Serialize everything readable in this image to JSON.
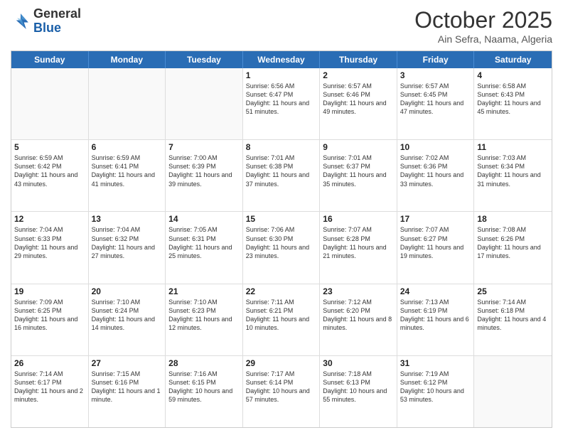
{
  "header": {
    "logo_general": "General",
    "logo_blue": "Blue",
    "month_title": "October 2025",
    "subtitle": "Ain Sefra, Naama, Algeria"
  },
  "days_of_week": [
    "Sunday",
    "Monday",
    "Tuesday",
    "Wednesday",
    "Thursday",
    "Friday",
    "Saturday"
  ],
  "rows": [
    [
      {
        "day": "",
        "sunrise": "",
        "sunset": "",
        "daylight": ""
      },
      {
        "day": "",
        "sunrise": "",
        "sunset": "",
        "daylight": ""
      },
      {
        "day": "",
        "sunrise": "",
        "sunset": "",
        "daylight": ""
      },
      {
        "day": "1",
        "sunrise": "Sunrise: 6:56 AM",
        "sunset": "Sunset: 6:47 PM",
        "daylight": "Daylight: 11 hours and 51 minutes."
      },
      {
        "day": "2",
        "sunrise": "Sunrise: 6:57 AM",
        "sunset": "Sunset: 6:46 PM",
        "daylight": "Daylight: 11 hours and 49 minutes."
      },
      {
        "day": "3",
        "sunrise": "Sunrise: 6:57 AM",
        "sunset": "Sunset: 6:45 PM",
        "daylight": "Daylight: 11 hours and 47 minutes."
      },
      {
        "day": "4",
        "sunrise": "Sunrise: 6:58 AM",
        "sunset": "Sunset: 6:43 PM",
        "daylight": "Daylight: 11 hours and 45 minutes."
      }
    ],
    [
      {
        "day": "5",
        "sunrise": "Sunrise: 6:59 AM",
        "sunset": "Sunset: 6:42 PM",
        "daylight": "Daylight: 11 hours and 43 minutes."
      },
      {
        "day": "6",
        "sunrise": "Sunrise: 6:59 AM",
        "sunset": "Sunset: 6:41 PM",
        "daylight": "Daylight: 11 hours and 41 minutes."
      },
      {
        "day": "7",
        "sunrise": "Sunrise: 7:00 AM",
        "sunset": "Sunset: 6:39 PM",
        "daylight": "Daylight: 11 hours and 39 minutes."
      },
      {
        "day": "8",
        "sunrise": "Sunrise: 7:01 AM",
        "sunset": "Sunset: 6:38 PM",
        "daylight": "Daylight: 11 hours and 37 minutes."
      },
      {
        "day": "9",
        "sunrise": "Sunrise: 7:01 AM",
        "sunset": "Sunset: 6:37 PM",
        "daylight": "Daylight: 11 hours and 35 minutes."
      },
      {
        "day": "10",
        "sunrise": "Sunrise: 7:02 AM",
        "sunset": "Sunset: 6:36 PM",
        "daylight": "Daylight: 11 hours and 33 minutes."
      },
      {
        "day": "11",
        "sunrise": "Sunrise: 7:03 AM",
        "sunset": "Sunset: 6:34 PM",
        "daylight": "Daylight: 11 hours and 31 minutes."
      }
    ],
    [
      {
        "day": "12",
        "sunrise": "Sunrise: 7:04 AM",
        "sunset": "Sunset: 6:33 PM",
        "daylight": "Daylight: 11 hours and 29 minutes."
      },
      {
        "day": "13",
        "sunrise": "Sunrise: 7:04 AM",
        "sunset": "Sunset: 6:32 PM",
        "daylight": "Daylight: 11 hours and 27 minutes."
      },
      {
        "day": "14",
        "sunrise": "Sunrise: 7:05 AM",
        "sunset": "Sunset: 6:31 PM",
        "daylight": "Daylight: 11 hours and 25 minutes."
      },
      {
        "day": "15",
        "sunrise": "Sunrise: 7:06 AM",
        "sunset": "Sunset: 6:30 PM",
        "daylight": "Daylight: 11 hours and 23 minutes."
      },
      {
        "day": "16",
        "sunrise": "Sunrise: 7:07 AM",
        "sunset": "Sunset: 6:28 PM",
        "daylight": "Daylight: 11 hours and 21 minutes."
      },
      {
        "day": "17",
        "sunrise": "Sunrise: 7:07 AM",
        "sunset": "Sunset: 6:27 PM",
        "daylight": "Daylight: 11 hours and 19 minutes."
      },
      {
        "day": "18",
        "sunrise": "Sunrise: 7:08 AM",
        "sunset": "Sunset: 6:26 PM",
        "daylight": "Daylight: 11 hours and 17 minutes."
      }
    ],
    [
      {
        "day": "19",
        "sunrise": "Sunrise: 7:09 AM",
        "sunset": "Sunset: 6:25 PM",
        "daylight": "Daylight: 11 hours and 16 minutes."
      },
      {
        "day": "20",
        "sunrise": "Sunrise: 7:10 AM",
        "sunset": "Sunset: 6:24 PM",
        "daylight": "Daylight: 11 hours and 14 minutes."
      },
      {
        "day": "21",
        "sunrise": "Sunrise: 7:10 AM",
        "sunset": "Sunset: 6:23 PM",
        "daylight": "Daylight: 11 hours and 12 minutes."
      },
      {
        "day": "22",
        "sunrise": "Sunrise: 7:11 AM",
        "sunset": "Sunset: 6:21 PM",
        "daylight": "Daylight: 11 hours and 10 minutes."
      },
      {
        "day": "23",
        "sunrise": "Sunrise: 7:12 AM",
        "sunset": "Sunset: 6:20 PM",
        "daylight": "Daylight: 11 hours and 8 minutes."
      },
      {
        "day": "24",
        "sunrise": "Sunrise: 7:13 AM",
        "sunset": "Sunset: 6:19 PM",
        "daylight": "Daylight: 11 hours and 6 minutes."
      },
      {
        "day": "25",
        "sunrise": "Sunrise: 7:14 AM",
        "sunset": "Sunset: 6:18 PM",
        "daylight": "Daylight: 11 hours and 4 minutes."
      }
    ],
    [
      {
        "day": "26",
        "sunrise": "Sunrise: 7:14 AM",
        "sunset": "Sunset: 6:17 PM",
        "daylight": "Daylight: 11 hours and 2 minutes."
      },
      {
        "day": "27",
        "sunrise": "Sunrise: 7:15 AM",
        "sunset": "Sunset: 6:16 PM",
        "daylight": "Daylight: 11 hours and 1 minute."
      },
      {
        "day": "28",
        "sunrise": "Sunrise: 7:16 AM",
        "sunset": "Sunset: 6:15 PM",
        "daylight": "Daylight: 10 hours and 59 minutes."
      },
      {
        "day": "29",
        "sunrise": "Sunrise: 7:17 AM",
        "sunset": "Sunset: 6:14 PM",
        "daylight": "Daylight: 10 hours and 57 minutes."
      },
      {
        "day": "30",
        "sunrise": "Sunrise: 7:18 AM",
        "sunset": "Sunset: 6:13 PM",
        "daylight": "Daylight: 10 hours and 55 minutes."
      },
      {
        "day": "31",
        "sunrise": "Sunrise: 7:19 AM",
        "sunset": "Sunset: 6:12 PM",
        "daylight": "Daylight: 10 hours and 53 minutes."
      },
      {
        "day": "",
        "sunrise": "",
        "sunset": "",
        "daylight": ""
      }
    ]
  ]
}
